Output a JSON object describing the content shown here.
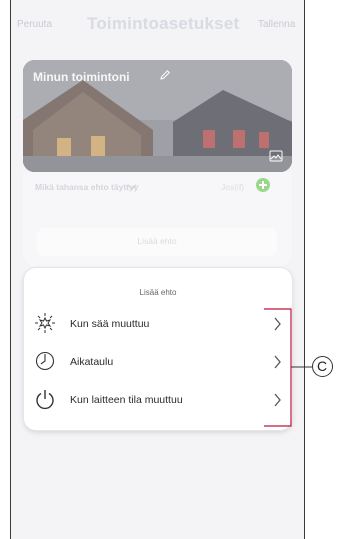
{
  "header": {
    "cancel_label": "Peruuta",
    "title": "Toimintoasetukset",
    "save_label": "Tallenna"
  },
  "automation_card": {
    "name": "Minun toimintoni",
    "edit_icon": "pencil-icon",
    "image_icon": "image-icon"
  },
  "conditions": {
    "match_label": "Mikä tahansa ehto täyttyy",
    "if_label": "Jos(if)",
    "add_label": "Lisää ehto"
  },
  "add_condition_sheet": {
    "title": "Lisää ehto",
    "options": [
      {
        "label": "Kun sää muuttuu",
        "icon": "weather-sun-icon"
      },
      {
        "label": "Aikataulu",
        "icon": "clock-icon"
      },
      {
        "label": "Kun laitteen tila muuttuu",
        "icon": "power-icon"
      }
    ]
  },
  "annotation": {
    "label": "C"
  },
  "colors": {
    "accent_green": "#9ad78a",
    "callout_red": "#c0143c"
  }
}
